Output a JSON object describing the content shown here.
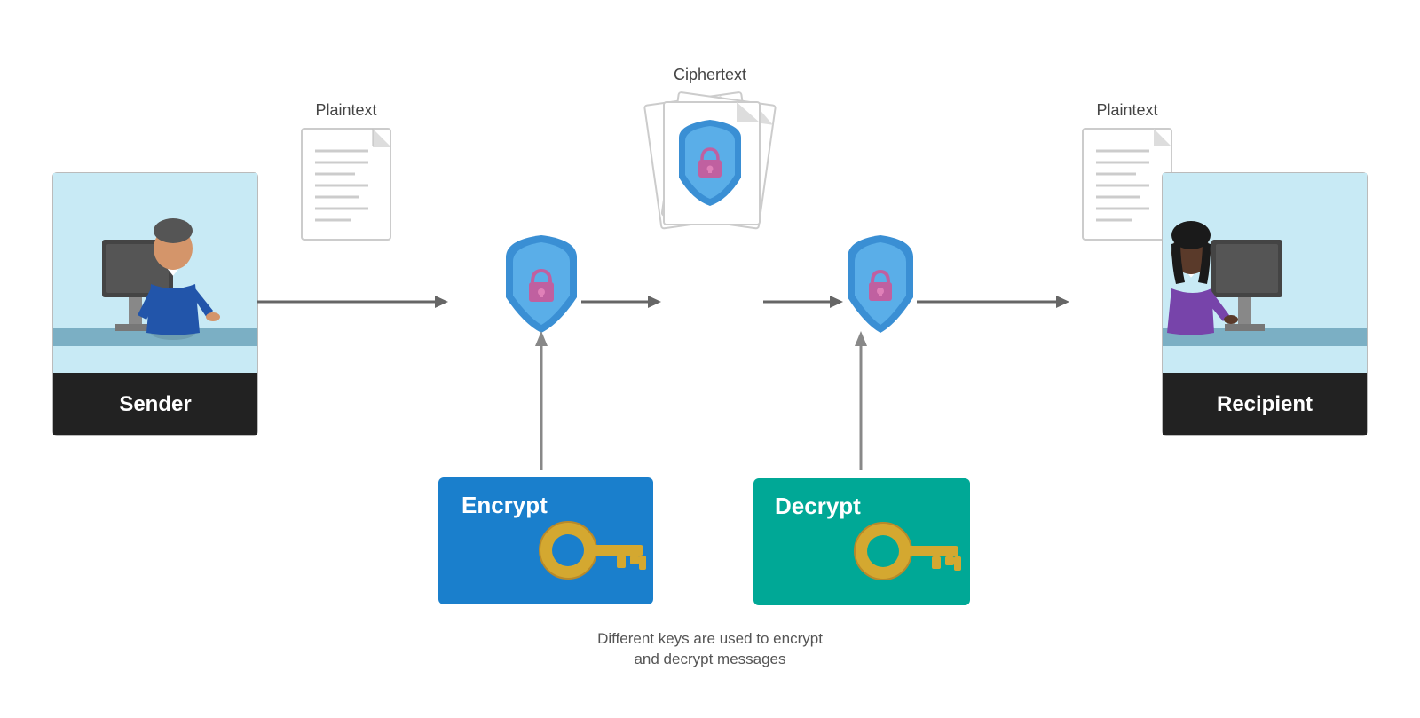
{
  "sender": {
    "label": "Sender"
  },
  "recipient": {
    "label": "Recipient"
  },
  "plaintext_left": {
    "label": "Plaintext"
  },
  "plaintext_right": {
    "label": "Plaintext"
  },
  "ciphertext": {
    "label": "Ciphertext"
  },
  "encrypt_key": {
    "label": "Encrypt"
  },
  "decrypt_key": {
    "label": "Decrypt"
  },
  "caption": {
    "line1": "Different keys are used to encrypt",
    "line2": "and decrypt messages"
  }
}
